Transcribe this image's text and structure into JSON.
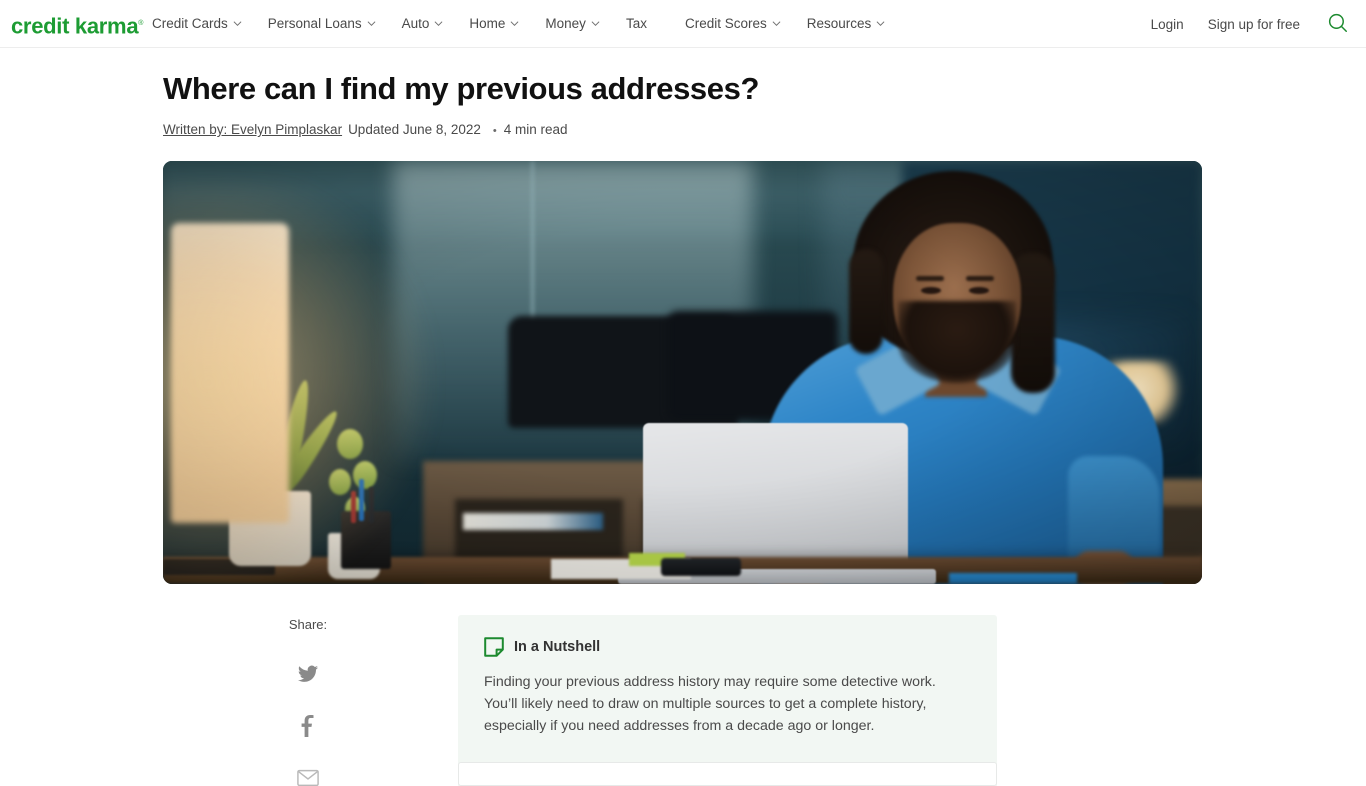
{
  "header": {
    "logo": "credit karma",
    "logo_tm": "®",
    "logo_color": "#1d9c33",
    "nav": [
      {
        "label": "Credit Cards",
        "has_dropdown": true
      },
      {
        "label": "Personal Loans",
        "has_dropdown": true
      },
      {
        "label": "Auto",
        "has_dropdown": true
      },
      {
        "label": "Home",
        "has_dropdown": true
      },
      {
        "label": "Money",
        "has_dropdown": true
      },
      {
        "label": "Tax",
        "has_dropdown": false
      },
      {
        "label": "Credit Scores",
        "has_dropdown": true
      },
      {
        "label": "Resources",
        "has_dropdown": true
      }
    ],
    "login_label": "Login",
    "signup_label": "Sign up for free",
    "search_icon": "search-icon"
  },
  "article": {
    "title": "Where can I find my previous addresses?",
    "author_prefix": "Written by:",
    "author": "Evelyn Pimplaskar",
    "author_full": "Written by: Evelyn Pimplaskar",
    "updated": "Updated June 8, 2022",
    "separator": "•",
    "read_time": "4 min read",
    "hero_alt": "Man in a blue denim shirt working on a laptop at a desk in a dimly lit office"
  },
  "share": {
    "label": "Share:",
    "items": [
      {
        "name": "twitter-icon",
        "label": "Share on Twitter"
      },
      {
        "name": "facebook-icon",
        "label": "Share on Facebook"
      },
      {
        "name": "email-icon",
        "label": "Share by email"
      }
    ]
  },
  "nutshell": {
    "icon": "note-icon",
    "icon_color": "#1d8a2f",
    "title": "In a Nutshell",
    "body": "Finding your previous address history may require some detective work. You’ll likely need to draw on multiple sources to get a complete history, especially if you need addresses from a decade ago or longer.",
    "background": "#f2f7f3"
  }
}
